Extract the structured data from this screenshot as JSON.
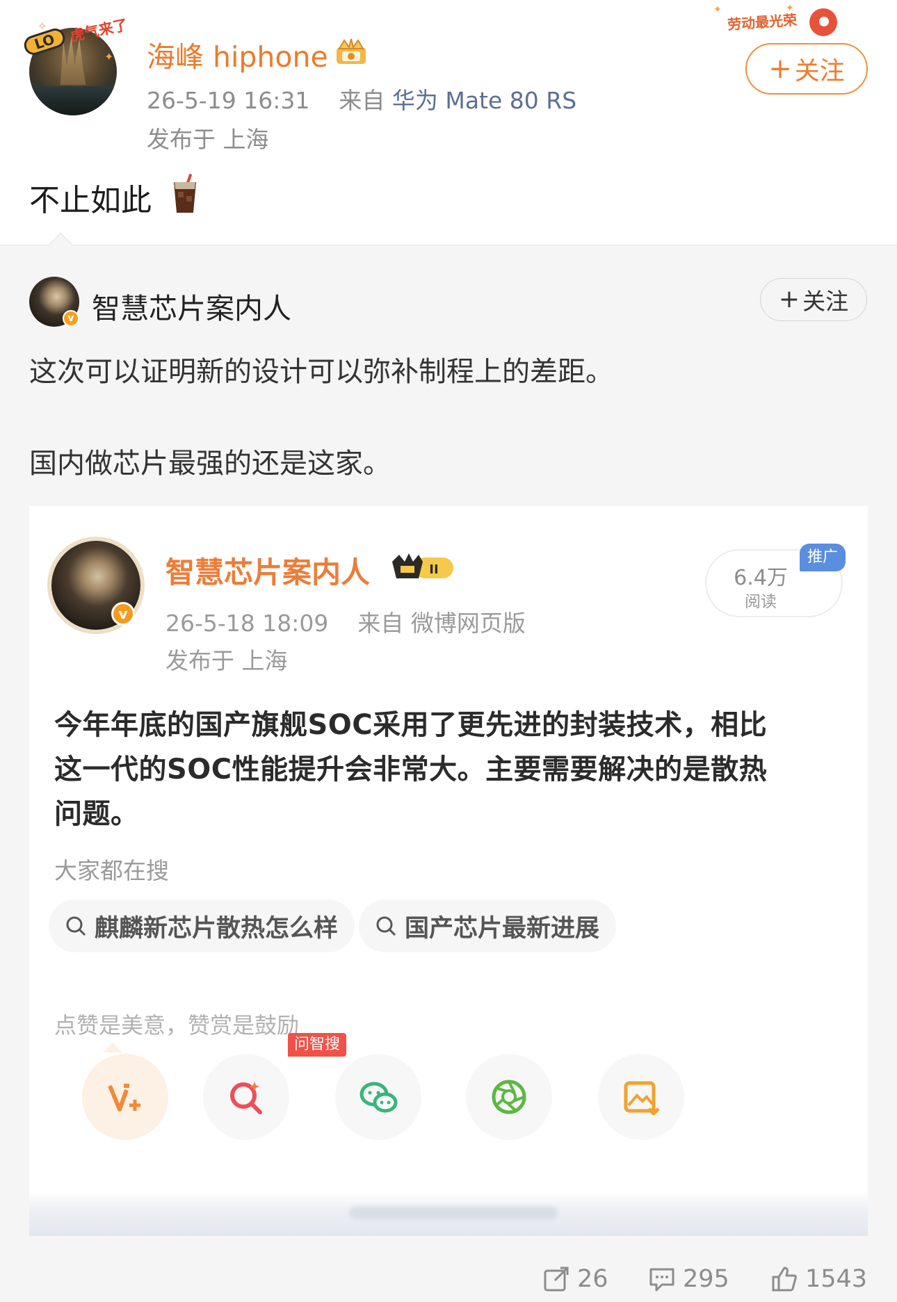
{
  "post": {
    "author_name": "海峰 hiphone",
    "avatar_frame_text": "虎气来了",
    "meta_time": "26-5-19 16:31",
    "meta_source_prefix": "来自",
    "meta_source_device": "华为 Mate 80 RS",
    "location": "发布于 上海",
    "labor_badge_text": "劳动最光荣",
    "follow_label": "关注",
    "text": "不止如此"
  },
  "repost": {
    "author_name": "智慧芯片案内人",
    "follow_label": "关注",
    "lines": [
      "这次可以证明新的设计可以弥补制程上的差距。",
      "国内做芯片最强的还是这家。"
    ],
    "embedded": {
      "author_name": "智慧芯片案内人",
      "level_badge": "II",
      "meta_time": "26-5-18 18:09",
      "meta_source": "来自 微博网页版",
      "location": "发布于 上海",
      "reads_count": "6.4万",
      "reads_label": "阅读",
      "promo_tag": "推广",
      "body_lines": [
        "今年年底的国产旗舰SOC采用了更先进的封装技术，相比",
        "这一代的SOC性能提升会非常大。主要需要解决的是散热",
        "问题。"
      ],
      "search_title": "大家都在搜",
      "search_chips": [
        "麒麟新芯片散热怎么样",
        "国产芯片最新进展"
      ],
      "tip_text": "点赞是美意，赞赏是鼓励",
      "ask_tag": "问智搜",
      "share_buttons": [
        "reward-icon",
        "ai-search-icon",
        "wechat-icon",
        "moments-icon",
        "save-image-icon"
      ]
    }
  },
  "actions": {
    "reposts": "26",
    "comments": "295",
    "likes": "1543"
  },
  "colors": {
    "accent_orange": "#ec7a2c",
    "source_blue": "#5b6f96",
    "promo_blue": "#5a8ede",
    "tag_red": "#f05248"
  }
}
